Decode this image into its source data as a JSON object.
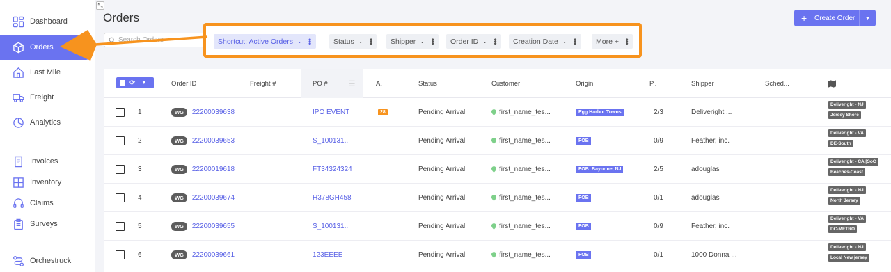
{
  "sidebar": {
    "items": [
      {
        "label": "Dashboard",
        "icon": "dashboard-icon"
      },
      {
        "label": "Orders",
        "icon": "box-icon",
        "active": true
      },
      {
        "label": "Last Mile",
        "icon": "house-icon"
      },
      {
        "label": "Freight",
        "icon": "truck-icon"
      },
      {
        "label": "Analytics",
        "icon": "analytics-icon"
      },
      {
        "label": "Invoices",
        "icon": "invoice-icon"
      },
      {
        "label": "Inventory",
        "icon": "inventory-icon"
      },
      {
        "label": "Claims",
        "icon": "headset-icon"
      },
      {
        "label": "Surveys",
        "icon": "clipboard-icon"
      },
      {
        "label": "Orchestruck",
        "icon": "route-icon"
      }
    ]
  },
  "header": {
    "title": "Orders",
    "search_placeholder": "Search Orders",
    "create_label": "Create Order"
  },
  "filters": {
    "shortcut": "Shortcut: Active Orders",
    "status": "Status",
    "shipper": "Shipper",
    "order_id": "Order ID",
    "creation_date": "Creation Date",
    "more": "More +"
  },
  "colors": {
    "accent": "#6a73f0",
    "highlight": "#f7931e"
  },
  "table": {
    "columns": {
      "order_id": "Order ID",
      "freight": "Freight #",
      "po": "PO #",
      "a": "A.",
      "status": "Status",
      "customer": "Customer",
      "origin": "Origin",
      "p": "P..",
      "shipper": "Shipper",
      "sched": "Sched..."
    },
    "rows": [
      {
        "num": "1",
        "tag": "WG",
        "order_id": "22200039638",
        "po": "IPO EVENT",
        "a": "28",
        "status": "Pending Arrival",
        "customer": "first_name_tes...",
        "origin": "Egg Harbor Towns",
        "p": "2/3",
        "shipper": "Deliveright ...",
        "tag1": "Deliveright - NJ",
        "tag2": "Jersey Shore"
      },
      {
        "num": "2",
        "tag": "WG",
        "order_id": "22200039653",
        "po": "S_100131...",
        "a": "",
        "status": "Pending Arrival",
        "customer": "first_name_tes...",
        "origin": "FOB",
        "p": "0/9",
        "shipper": "Feather, inc.",
        "tag1": "Deliveright - VA",
        "tag2": "DE-South"
      },
      {
        "num": "3",
        "tag": "WG",
        "order_id": "22200019618",
        "po": "FT34324324",
        "a": "",
        "status": "Pending Arrival",
        "customer": "first_name_tes...",
        "origin": "FOB: Bayonne, NJ",
        "p": "2/5",
        "shipper": "adouglas",
        "tag1": "Deliveright - CA [SoC",
        "tag2": "Beaches-Coast"
      },
      {
        "num": "4",
        "tag": "WG",
        "order_id": "22200039674",
        "po": "H378GH458",
        "a": "",
        "status": "Pending Arrival",
        "customer": "first_name_tes...",
        "origin": "FOB",
        "p": "0/1",
        "shipper": "adouglas",
        "tag1": "Deliveright - NJ",
        "tag2": "North Jersey"
      },
      {
        "num": "5",
        "tag": "WG",
        "order_id": "22200039655",
        "po": "S_100131...",
        "a": "",
        "status": "Pending Arrival",
        "customer": "first_name_tes...",
        "origin": "FOB",
        "p": "0/9",
        "shipper": "Feather, inc.",
        "tag1": "Deliveright - VA",
        "tag2": "DC-METRO"
      },
      {
        "num": "6",
        "tag": "WG",
        "order_id": "22200039661",
        "po": "123EEEE",
        "a": "",
        "status": "Pending Arrival",
        "customer": "first_name_tes...",
        "origin": "FOB",
        "p": "0/1",
        "shipper": "1000 Donna ...",
        "tag1": "Deliveright - NJ",
        "tag2": "Local New jersey"
      }
    ]
  }
}
